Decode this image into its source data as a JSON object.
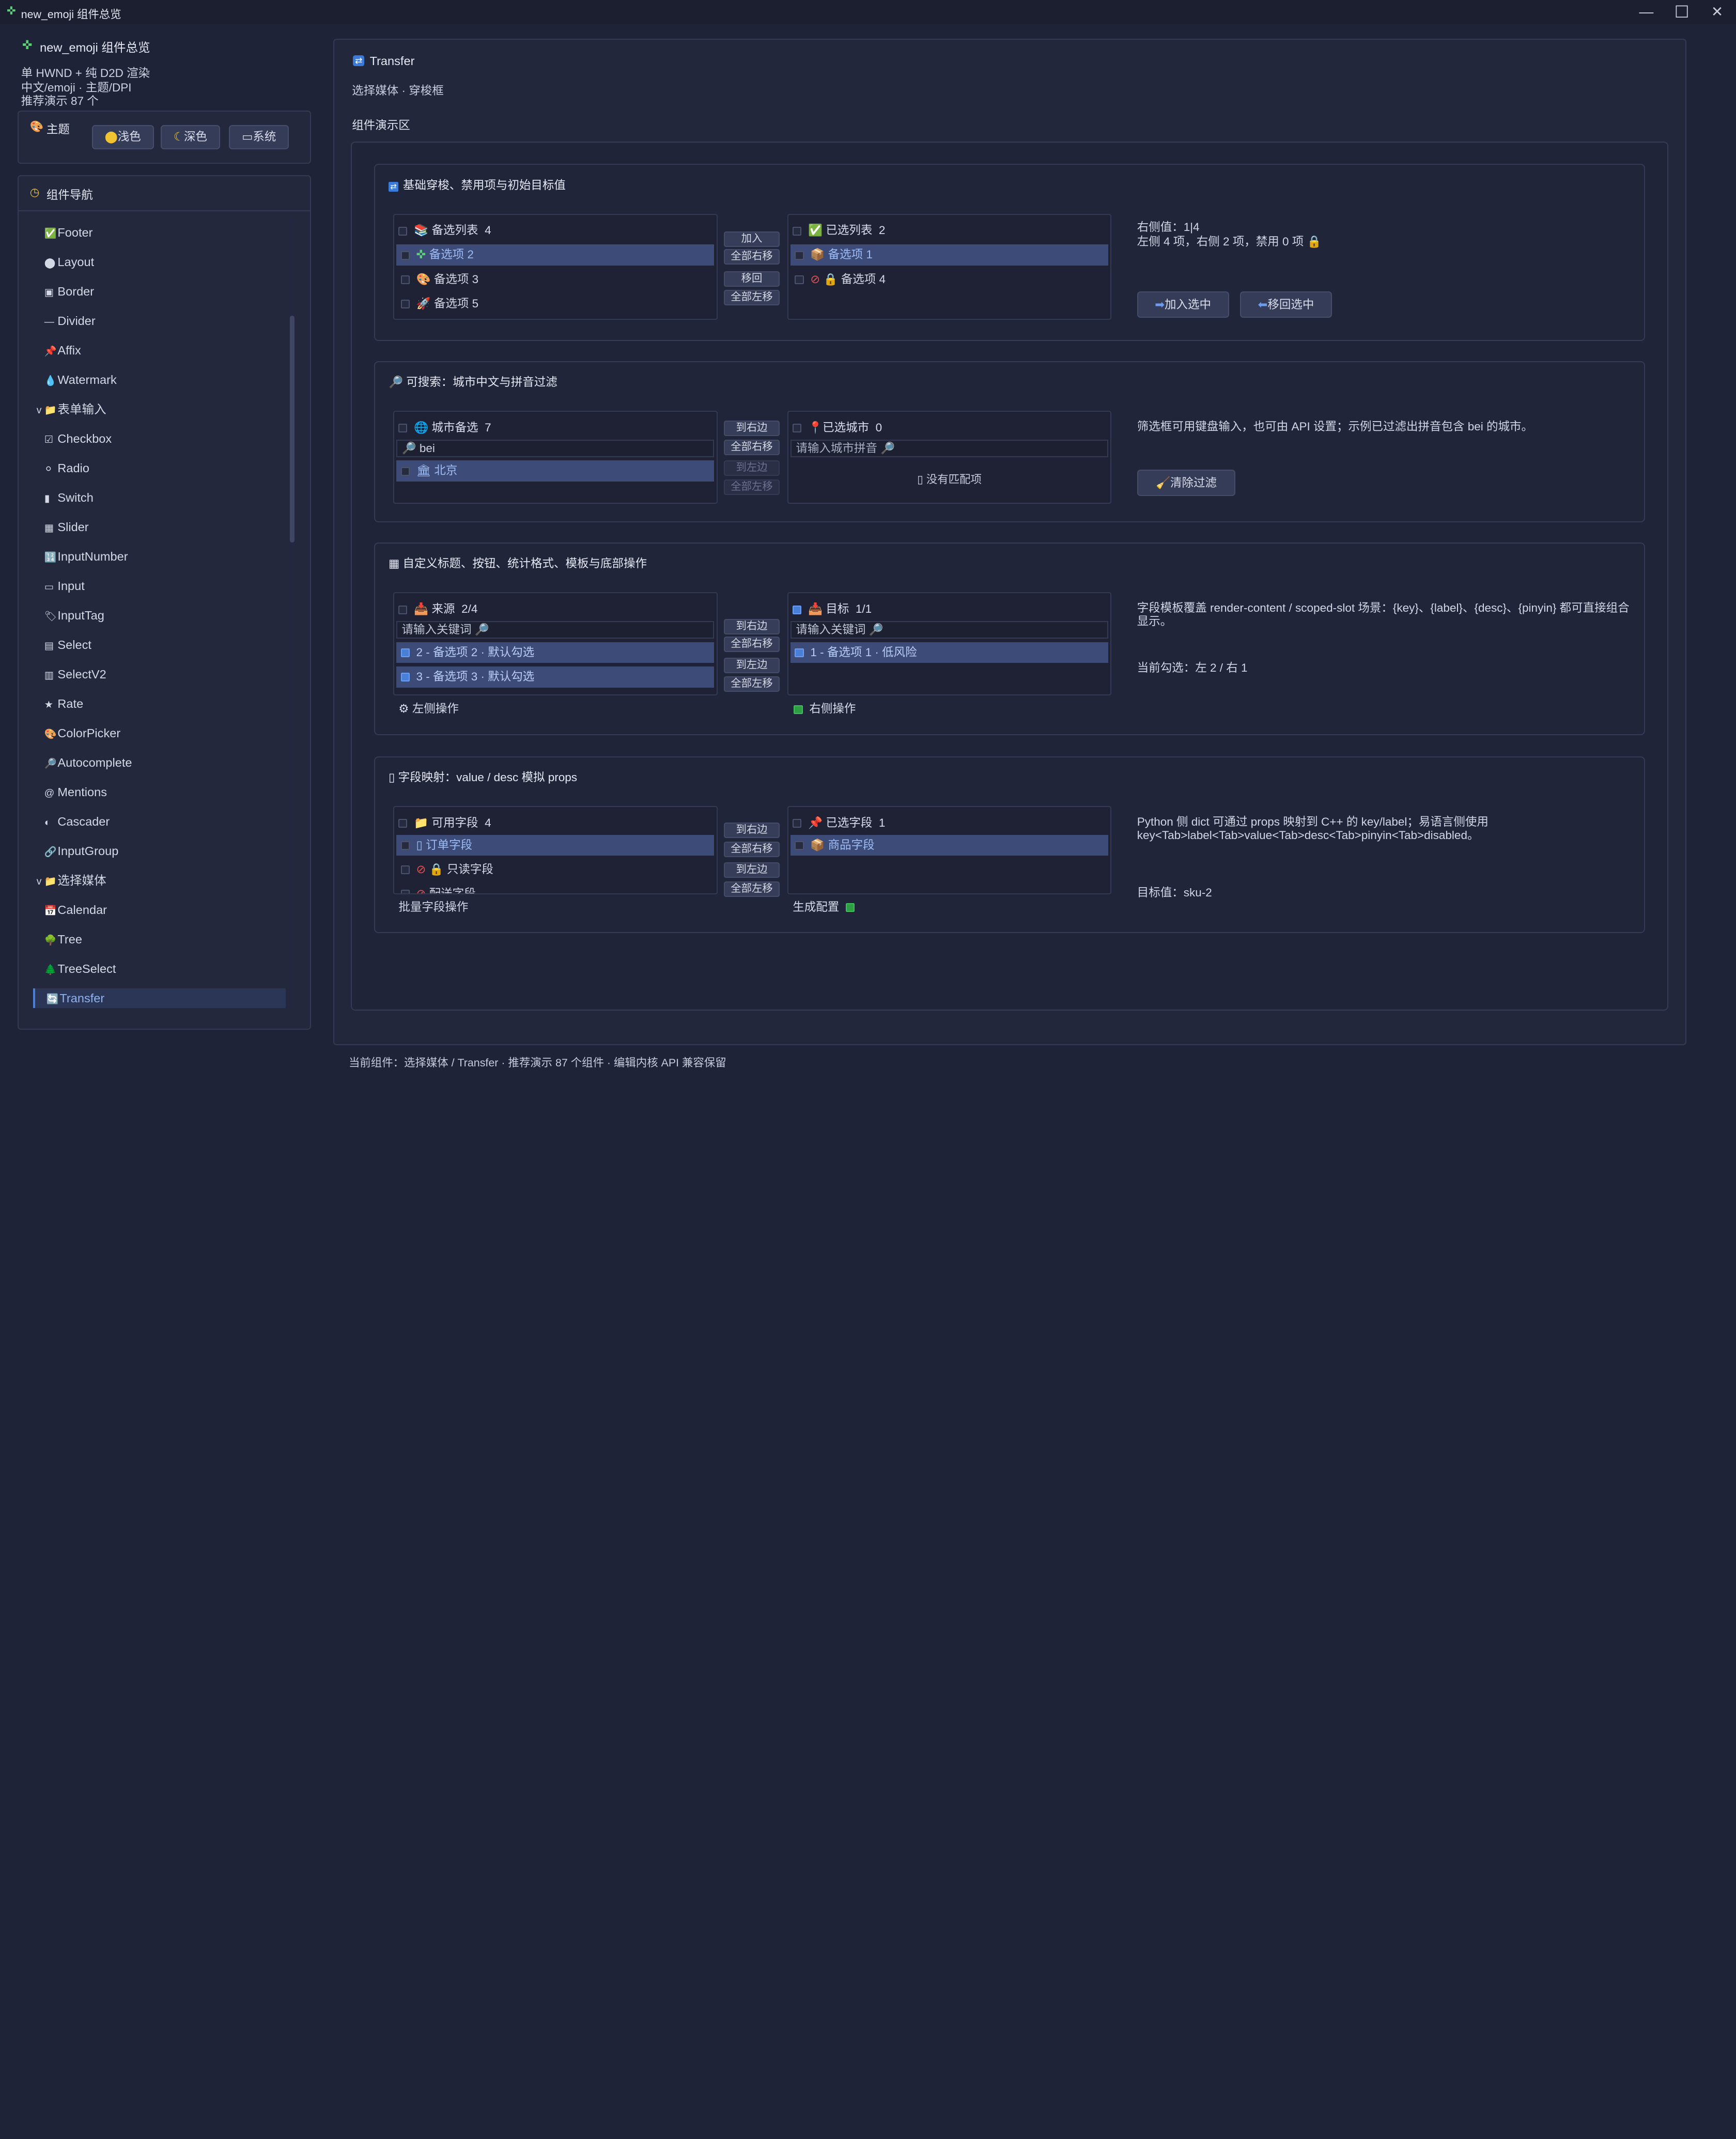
{
  "window": {
    "title": "new_emoji 组件总览",
    "min": "—",
    "max": "☐",
    "close": "✕"
  },
  "sidebar": {
    "app_title": "new_emoji 组件总览",
    "info": [
      "单 HWND + 纯 D2D 渲染",
      "中文/emoji · 主题/DPI",
      "推荐演示 87 个"
    ],
    "theme": {
      "label": "主题",
      "light": "浅色",
      "dark": "深色",
      "system": "系统"
    },
    "nav_title": "组件导航",
    "items": [
      {
        "icon": "✅",
        "label": "Footer"
      },
      {
        "icon": "⬤",
        "label": "Layout"
      },
      {
        "icon": "▣",
        "label": "Border"
      },
      {
        "icon": "—",
        "label": "Divider"
      },
      {
        "icon": "📌",
        "label": "Affix"
      },
      {
        "icon": "💧",
        "label": "Watermark"
      },
      {
        "icon": "v 📁",
        "label": "表单输入"
      },
      {
        "icon": "☑",
        "label": "Checkbox"
      },
      {
        "icon": "⚪",
        "label": "Radio"
      },
      {
        "icon": "▮",
        "label": "Switch"
      },
      {
        "icon": "▦",
        "label": "Slider"
      },
      {
        "icon": "🔢",
        "label": "InputNumber"
      },
      {
        "icon": "▭",
        "label": "Input"
      },
      {
        "icon": "🏷",
        "label": "InputTag"
      },
      {
        "icon": "▤",
        "label": "Select"
      },
      {
        "icon": "▥",
        "label": "SelectV2"
      },
      {
        "icon": "★",
        "label": "Rate"
      },
      {
        "icon": "🎨",
        "label": "ColorPicker"
      },
      {
        "icon": "🔎",
        "label": "Autocomplete"
      },
      {
        "icon": "@",
        "label": "Mentions"
      },
      {
        "icon": "◐",
        "label": "Cascader"
      },
      {
        "icon": "🔗",
        "label": "InputGroup"
      },
      {
        "icon": "v 📁",
        "label": "选择媒体"
      },
      {
        "icon": "📅",
        "label": "Calendar"
      },
      {
        "icon": "🌳",
        "label": "Tree"
      },
      {
        "icon": "🌲",
        "label": "TreeSelect"
      },
      {
        "icon": "🔄",
        "label": "Transfer"
      }
    ]
  },
  "main": {
    "title": "Transfer",
    "subtitle": "选择媒体 · 穿梭框",
    "demo_label": "组件演示区",
    "status": "当前组件：选择媒体 / Transfer · 推荐演示 87 个组件 · 编辑内核 API 兼容保留"
  },
  "sec1": {
    "title": "基础穿梭、禁用项与初始目标值",
    "left_title": "备选列表",
    "left_count": "4",
    "left_items": [
      "备选项 2",
      "备选项 3",
      "备选项 5"
    ],
    "right_title": "已选列表",
    "right_count": "2",
    "right_items": [
      "备选项 1",
      "备选项 4"
    ],
    "btn_add": "加入",
    "btn_all_right": "全部右移",
    "btn_back": "移回",
    "btn_all_left": "全部左移",
    "note1": "右侧值：1|4",
    "note2": "左侧 4 项，右侧 2 项，禁用 0 项 🔒",
    "action1": "加入选中",
    "action2": "移回选中"
  },
  "sec2": {
    "title": "可搜索：城市中文与拼音过滤",
    "left_title": "城市备选",
    "left_count": "7",
    "left_search": "bei",
    "left_items": [
      "北京"
    ],
    "right_title": "已选城市",
    "right_count": "0",
    "right_placeholder": "请输入城市拼音",
    "empty": "没有匹配项",
    "btn_to_right": "到右边",
    "btn_all_right": "全部右移",
    "btn_to_left": "到左边",
    "btn_all_left": "全部左移",
    "note": "筛选框可用键盘输入，也可由 API 设置；示例已过滤出拼音包含 bei 的城市。",
    "clear": "清除过滤"
  },
  "sec3": {
    "title": "自定义标题、按钮、统计格式、模板与底部操作",
    "left_title": "来源",
    "left_count": "2/4",
    "left_placeholder": "请输入关键词",
    "left_items": [
      "2 - 备选项 2 · 默认勾选",
      "3 - 备选项 3 · 默认勾选"
    ],
    "left_footer": "左侧操作",
    "right_title": "目标",
    "right_count": "1/1",
    "right_placeholder": "请输入关键词",
    "right_items": [
      "1 - 备选项 1 · 低风险"
    ],
    "right_footer": "右侧操作",
    "btn_to_right": "到右边",
    "btn_all_right": "全部右移",
    "btn_to_left": "到左边",
    "btn_all_left": "全部左移",
    "note1": "字段模板覆盖 render-content / scoped-slot 场景：{key}、{label}、{desc}、{pinyin} 都可直接组合",
    "note1b": "显示。",
    "note2": "当前勾选：左 2 / 右 1"
  },
  "sec4": {
    "title": "字段映射：value / desc 模拟 props",
    "left_title": "可用字段",
    "left_count": "4",
    "left_items": [
      "订单字段",
      "只读字段",
      "配送字段"
    ],
    "left_footer": "批量字段操作",
    "right_title": "已选字段",
    "right_count": "1",
    "right_items": [
      "商品字段"
    ],
    "right_footer": "生成配置",
    "btn_to_right": "到右边",
    "btn_all_right": "全部右移",
    "btn_to_left": "到左边",
    "btn_all_left": "全部左移",
    "note1": "Python 侧 dict 可通过 props 映射到 C++ 的 key/label；易语言侧使用",
    "note1b": "key<Tab>label<Tab>value<Tab>desc<Tab>pinyin<Tab>disabled。",
    "note2": "目标值：sku-2"
  },
  "colors": {
    "background": "#1f2337",
    "panel": "#23283c",
    "accent": "#4a7fd8",
    "selected_row": "#3d4b78"
  }
}
